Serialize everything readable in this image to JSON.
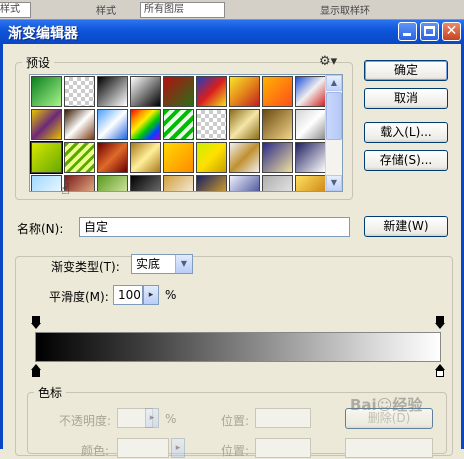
{
  "background": {
    "left_field": "样式",
    "middle_label": "样式",
    "middle_value": "所有图层",
    "checkbox_label": "显示取样环"
  },
  "window": {
    "title": "渐变编辑器",
    "close_glyph": "✕"
  },
  "presets": {
    "legend": "预设",
    "gear_glyph": "⚙",
    "swatches": [
      "linear-gradient(135deg,#0a7f1f,#a7f58a)",
      "repeating-conic-gradient(#ccc 0% 25%, #fff 0% 50%) 0 0/8px 8px",
      "linear-gradient(135deg,#000,#fff)",
      "linear-gradient(135deg,#ffffff,#000000)",
      "linear-gradient(135deg,#b21010,#2a6f1a)",
      "linear-gradient(135deg,#1d3fc2,#d81d1d,#f3e11f)",
      "linear-gradient(135deg,#f7e52a,#e4871a,#c02020)",
      "linear-gradient(135deg,#ffb200,#ff4e1a)",
      "linear-gradient(135deg,#1f4fd6,#f0f0f0,#d12020)",
      "linear-gradient(135deg,#e8c100,#6b2a7a,#e8c100)",
      "linear-gradient(135deg,#3a1a00,#ffffff,#7a3a14)",
      "linear-gradient(135deg,#4aa0ff,#ffffff,#2266dd)",
      "linear-gradient(135deg,#ff0000,#ff8800,#ffee00,#00cc00,#0044ff,#aa00cc)",
      "repeating-linear-gradient(135deg,#00bb00 0px,#00bb00 4px,#e6ffe6 4px,#e6ffe6 8px)",
      "repeating-conic-gradient(#ccc 0% 25%, #fff 0% 50%) 0 0/8px 8px",
      "linear-gradient(135deg,#8a6d1a,#f5e6a8,#8a6d1a)",
      "linear-gradient(135deg,#6b4a10,#f3d58a)",
      "linear-gradient(135deg,#d4d4d4,#ffffff,#8c8c8c)",
      "linear-gradient(135deg,#d6e800,#68a800)",
      "repeating-linear-gradient(135deg,#5aa800 0px,#5aa800 3px,#e8ff8a 3px,#e8ff8a 7px)",
      "linear-gradient(135deg,#6a0000,#e06a2a,#6a0000)",
      "linear-gradient(135deg,#a87a1a,#ffef9a,#a87a1a)",
      "linear-gradient(135deg,#ffd900,#ff8a00)",
      "linear-gradient(135deg,#c8f000,#ffe000,#c8a000)",
      "linear-gradient(135deg,#f0f0f0,#c09030,#f0f0f0)",
      "linear-gradient(135deg,#2a2a8a,#f0e0a0)",
      "linear-gradient(135deg,#202060,#ffffff)",
      "linear-gradient(135deg,#a0d8ff,#ffffff)",
      "linear-gradient(135deg,#7a1a1a,#ffd6a0)",
      "linear-gradient(135deg,#5a9a20,#f0f8c0)",
      "linear-gradient(135deg,#000000,#8a8a8a)",
      "linear-gradient(135deg,#d0a040,#ffffff)",
      "linear-gradient(135deg,#1a2060,#ffc020)",
      "linear-gradient(135deg,#f0f0ff,#203080)",
      "linear-gradient(135deg,#b0b0b0,#f0f0f0)",
      "linear-gradient(135deg,#ffe060,#c07000)",
      "linear-gradient(135deg,#80d0ff,#2060c0)",
      "linear-gradient(135deg,#603060,#e0a0e0)",
      "linear-gradient(135deg,#f0d060,#807020)",
      "linear-gradient(135deg,#e0e0ff,#404080)",
      "linear-gradient(135deg,#402010,#c08040)",
      "linear-gradient(135deg,#ffffff,#606060)",
      "linear-gradient(135deg,#408040,#c0f0c0)",
      "linear-gradient(135deg,#200040,#8040c0)",
      "linear-gradient(135deg,#102040,#4060a0)",
      "linear-gradient(135deg,#ffa0a0,#a02020)",
      "linear-gradient(135deg,#f0f0a0,#a0a040)",
      "linear-gradient(135deg,#2040a0,#000040)",
      "linear-gradient(135deg,#0a2a9a,#e0e0ff)"
    ]
  },
  "buttons": {
    "ok": "确定",
    "cancel": "取消",
    "load": "载入(L)...",
    "save": "存储(S)...",
    "new": "新建(W)"
  },
  "name_field": {
    "label": "名称(N):",
    "value": "自定"
  },
  "gradient_type": {
    "label": "渐变类型(T):",
    "value": "实底"
  },
  "smoothness": {
    "label": "平滑度(M):",
    "value": "100",
    "unit": "%"
  },
  "stops_group": {
    "legend": "色标",
    "opacity_label": "不透明度:",
    "opacity_unit": "%",
    "position_label": "位置:",
    "delete_label": "删除(D)",
    "color_label": "颜色:",
    "position2_label": "位置:"
  },
  "colors": {
    "titlebar": "#0a47c4",
    "gradient_start": "#000000",
    "gradient_end": "#ffffff"
  }
}
